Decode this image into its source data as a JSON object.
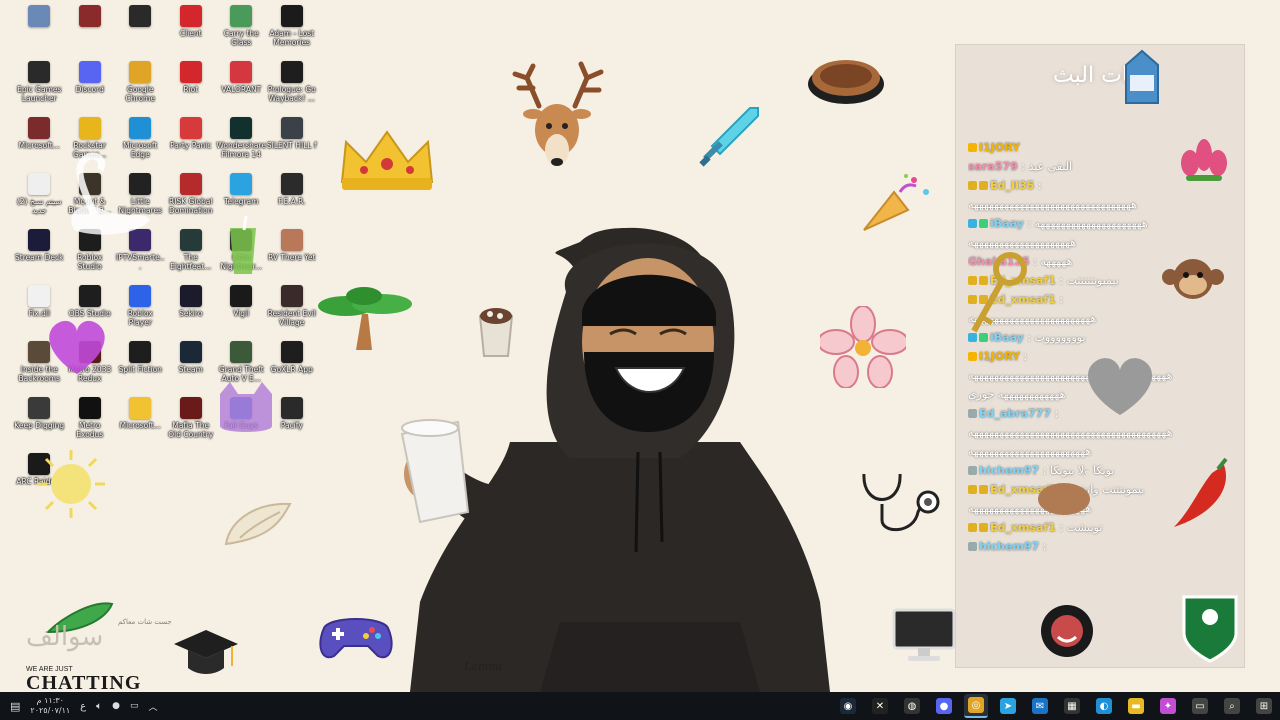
{
  "desktop_icons": [
    {
      "label": "",
      "color": "#6a89b7",
      "name": "recycle-bin-icon"
    },
    {
      "label": "",
      "color": "#8b2a2a",
      "name": "winrar-icon"
    },
    {
      "label": "",
      "color": "#2a2a2a",
      "name": "crossed-tools-icon"
    },
    {
      "label": "Client",
      "color": "#d3272b",
      "name": "riot-client-icon"
    },
    {
      "label": "Carry the Glass",
      "color": "#4a9b5a",
      "name": "carry-the-glass-icon"
    },
    {
      "label": "Adam - Lost Memories",
      "color": "#1b1b1b",
      "name": "adam-lost-memories-icon"
    },
    {
      "label": "Epic Games Launcher",
      "color": "#2a2a2a",
      "name": "epic-games-icon"
    },
    {
      "label": "Discord",
      "color": "#5865f2",
      "name": "discord-icon"
    },
    {
      "label": "Google Chrome",
      "color": "#e0a526",
      "name": "chrome-icon"
    },
    {
      "label": "Riot",
      "color": "#d3272b",
      "name": "riot-icon"
    },
    {
      "label": "VALORANT",
      "color": "#d4373f",
      "name": "valorant-icon"
    },
    {
      "label": "Prologue: Go Wayback! ...",
      "color": "#1e1e1e",
      "name": "prologue-icon"
    },
    {
      "label": "Microsoft...",
      "color": "#7a2b2b",
      "name": "microsoft-app-icon"
    },
    {
      "label": "Rockstar Games...",
      "color": "#e8b51c",
      "name": "rockstar-icon"
    },
    {
      "label": "Microsoft Edge",
      "color": "#1f8fd6",
      "name": "edge-icon"
    },
    {
      "label": "Party Panic",
      "color": "#d73a3a",
      "name": "party-panic-icon"
    },
    {
      "label": "Wondershare Filmora 14",
      "color": "#12312e",
      "name": "filmora-icon"
    },
    {
      "label": "SILENT HILL f",
      "color": "#3a4148",
      "name": "silent-hill-icon"
    },
    {
      "label": "ﺳﻴﺘﻢ ﻧﺴﺦ (2) ﺟﺪﻳﺪ",
      "color": "#efefef",
      "name": "text-file-icon"
    },
    {
      "label": "Mount & Blade II B...",
      "color": "#3c3428",
      "name": "mount-blade-icon"
    },
    {
      "label": "Little Nightmares",
      "color": "#222222",
      "name": "little-nightmares-icon"
    },
    {
      "label": "RISK Global Domination",
      "color": "#b52a2a",
      "name": "risk-icon"
    },
    {
      "label": "Telegram",
      "color": "#2aa3e0",
      "name": "telegram-icon"
    },
    {
      "label": "F.E.A.R.",
      "color": "#2b2b2b",
      "name": "fear-icon"
    },
    {
      "label": "Stream Deck",
      "color": "#1c1c3a",
      "name": "stream-deck-icon"
    },
    {
      "label": "Roblox Studio",
      "color": "#1d1d1d",
      "name": "roblox-studio-icon"
    },
    {
      "label": "IPTVSmarte...",
      "color": "#3b2a6b",
      "name": "iptv-icon"
    },
    {
      "label": "The Eightfeat...",
      "color": "#273a3a",
      "name": "eightfeat-icon"
    },
    {
      "label": "Little Nightmar...",
      "color": "#2f2f2f",
      "name": "little-nightmares-2-icon"
    },
    {
      "label": "RV There Yet",
      "color": "#b9785a",
      "name": "rv-there-yet-icon"
    },
    {
      "label": "Fix.dll",
      "color": "#f1f1f1",
      "name": "file-icon"
    },
    {
      "label": "OBS Studio",
      "color": "#1e1e1e",
      "name": "obs-icon"
    },
    {
      "label": "Roblox Player",
      "color": "#2d63e8",
      "name": "roblox-player-icon"
    },
    {
      "label": "Sekiro",
      "color": "#1b1b2b",
      "name": "sekiro-icon"
    },
    {
      "label": "Vigil",
      "color": "#1a1a1a",
      "name": "vigil-icon"
    },
    {
      "label": "Resident Evil Village",
      "color": "#3a2a2a",
      "name": "resident-evil-icon"
    },
    {
      "label": "Inside the Backrooms",
      "color": "#5a4a3a",
      "name": "backrooms-icon"
    },
    {
      "label": "Metro 2033 Redux",
      "color": "#5a1b1b",
      "name": "metro-2033-icon"
    },
    {
      "label": "Split Fiction",
      "color": "#1e1e1e",
      "name": "split-fiction-icon"
    },
    {
      "label": "Steam",
      "color": "#1b2838",
      "name": "steam-icon"
    },
    {
      "label": "Grand Theft Auto V E...",
      "color": "#3a5a3a",
      "name": "gta-icon"
    },
    {
      "label": "GoXLR App",
      "color": "#1e1e1e",
      "name": "goxlr-icon"
    },
    {
      "label": "Keep Digging",
      "color": "#3a3a3a",
      "name": "keep-digging-icon"
    },
    {
      "label": "Metro Exodus",
      "color": "#111111",
      "name": "metro-exodus-icon"
    },
    {
      "label": "Microsoft...",
      "color": "#f1c232",
      "name": "microsoft-app-2-icon"
    },
    {
      "label": "Mafia The Old Country",
      "color": "#6b1a1a",
      "name": "mafia-icon"
    },
    {
      "label": "Fall Guys",
      "color": "#3a7bd5",
      "name": "fall-guys-icon"
    },
    {
      "label": "Pacify",
      "color": "#2a2a2a",
      "name": "pacify-icon"
    },
    {
      "label": "ARC Raiders",
      "color": "#1a1a1a",
      "name": "arc-raiders-icon"
    }
  ],
  "overlay": {
    "artist_signature": "Lammi",
    "brand_line": "WE ARE JUST",
    "brand_big": "CHATTING",
    "brand_arabic": "سوالف",
    "brand_arabic_small": "جست شات معاكم"
  },
  "chat": {
    "title": "شات البث",
    "messages": [
      {
        "user": "I1JORY",
        "user_color": "#f4b400",
        "text": "",
        "badges": [
          "#f4b400"
        ]
      },
      {
        "user": "sara579",
        "user_color": "#f28fb0",
        "text": ": البقى عيد",
        "badges": []
      },
      {
        "user": "Ed_II35",
        "user_color": "#f4d03f",
        "text": ":",
        "badges": [
          "#e0b020",
          "#e0b020"
        ]
      },
      {
        "user": "",
        "user_color": "#ffffff",
        "text": "ههههههههههههههههههههههههههههههههه",
        "badges": []
      },
      {
        "user": "iBaay",
        "user_color": "#7fd3f7",
        "text": ": هههههههههههههههههههههه",
        "badges": [
          "#36b3e0",
          "#3ad07a"
        ]
      },
      {
        "user": "",
        "user_color": "#ffffff",
        "text": "ههههههههههههههههههههه",
        "badges": []
      },
      {
        "user": "GhaLa125",
        "user_color": "#f28fb0",
        "text": ": هههههه",
        "badges": []
      },
      {
        "user": "Ed_xmsaf1",
        "user_color": "#f4d03f",
        "text": ": بيمبونتتتتتت",
        "badges": [
          "#e0b020",
          "#e0b020"
        ]
      },
      {
        "user": "Ed_xmsaf1",
        "user_color": "#f4d03f",
        "text": ":",
        "badges": [
          "#e0b020",
          "#e0b020"
        ]
      },
      {
        "user": "",
        "user_color": "#ffffff",
        "text": "ههههههههههههههههههههههههه",
        "badges": []
      },
      {
        "user": "iBaay",
        "user_color": "#7fd3f7",
        "text": ": بوووووووت",
        "badges": [
          "#36b3e0",
          "#3ad07a"
        ]
      },
      {
        "user": "I1JORY",
        "user_color": "#f4b400",
        "text": ":",
        "badges": [
          "#f4b400"
        ]
      },
      {
        "user": "",
        "user_color": "#ffffff",
        "text": "هههههههههههههههههههههههههههههههههههههههه",
        "badges": []
      },
      {
        "user": "",
        "user_color": "#ffffff",
        "text": "ههههههههههههه جوري",
        "badges": []
      },
      {
        "user": "Ed_abra777",
        "user_color": "#7fd3f7",
        "text": ":",
        "badges": [
          "#9aa"
        ]
      },
      {
        "user": "",
        "user_color": "#ffffff",
        "text": "هههههههههههههههههههههههههههههههههههههههه",
        "badges": []
      },
      {
        "user": "",
        "user_color": "#ffffff",
        "text": "هههههههههههههههههههههههه",
        "badges": []
      },
      {
        "user": "hichem97",
        "user_color": "#7fd3f7",
        "text": ": بونكا ولا بيونكا",
        "badges": [
          "#9aa"
        ]
      },
      {
        "user": "Ed_xmsaf1",
        "user_color": "#f4d03f",
        "text": ": بيمونتتتت واتشت",
        "badges": [
          "#e0b020",
          "#e0b020"
        ]
      },
      {
        "user": "",
        "user_color": "#ffffff",
        "text": "هههههههههههههههههههههههه",
        "badges": []
      },
      {
        "user": "Ed_xmsaf1",
        "user_color": "#f4d03f",
        "text": ": تونيشت",
        "badges": [
          "#e0b020",
          "#e0b020"
        ]
      },
      {
        "user": "hichem97",
        "user_color": "#7fd3f7",
        "text": ":",
        "badges": [
          "#9aa"
        ]
      }
    ]
  },
  "taskbar": {
    "date": "٢٠٢٥/٠٧/١١",
    "time": "١١:٣٠ م",
    "lang": "ع",
    "apps": [
      {
        "name": "steam-taskbar-icon",
        "glyph": "◉",
        "color": "#1b2838"
      },
      {
        "name": "goxlr-taskbar-icon",
        "glyph": "✕",
        "color": "#222"
      },
      {
        "name": "obs-taskbar-icon",
        "glyph": "◍",
        "color": "#333"
      },
      {
        "name": "discord-taskbar-icon",
        "glyph": "●",
        "color": "#5865f2"
      },
      {
        "name": "chrome-taskbar-icon",
        "glyph": "◎",
        "color": "#e0a526",
        "active": true
      },
      {
        "name": "telegram-taskbar-icon",
        "glyph": "➤",
        "color": "#2aa3e0"
      },
      {
        "name": "outlook-taskbar-icon",
        "glyph": "✉",
        "color": "#1a73c5"
      },
      {
        "name": "store-taskbar-icon",
        "glyph": "▦",
        "color": "#333"
      },
      {
        "name": "edge-taskbar-icon",
        "glyph": "◐",
        "color": "#1f8fd6"
      },
      {
        "name": "explorer-taskbar-icon",
        "glyph": "▬",
        "color": "#e8b923"
      },
      {
        "name": "copilot-taskbar-icon",
        "glyph": "✦",
        "color": "#c24fd3"
      },
      {
        "name": "task-view-icon",
        "glyph": "▭",
        "color": "#444"
      },
      {
        "name": "search-taskbar-icon",
        "glyph": "⌕",
        "color": "#444"
      },
      {
        "name": "windows-start-icon",
        "glyph": "⊞",
        "color": "#444"
      }
    ]
  }
}
